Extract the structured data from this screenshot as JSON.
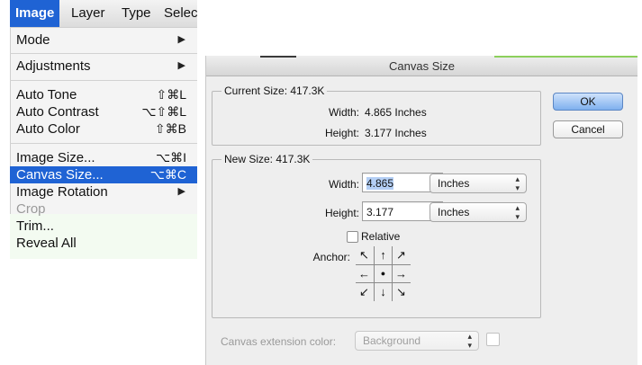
{
  "menubar": {
    "items": [
      "Image",
      "Layer",
      "Type",
      "Selec"
    ]
  },
  "menu": {
    "mode": {
      "label": "Mode"
    },
    "adjustments": {
      "label": "Adjustments"
    },
    "auto_tone": {
      "label": "Auto Tone",
      "shortcut": "⇧⌘L"
    },
    "auto_contrast": {
      "label": "Auto Contrast",
      "shortcut": "⌥⇧⌘L"
    },
    "auto_color": {
      "label": "Auto Color",
      "shortcut": "⇧⌘B"
    },
    "image_size": {
      "label": "Image Size...",
      "shortcut": "⌥⌘I"
    },
    "canvas_size": {
      "label": "Canvas Size...",
      "shortcut": "⌥⌘C"
    },
    "image_rotation": {
      "label": "Image Rotation"
    },
    "crop": {
      "label": "Crop"
    },
    "trim": {
      "label": "Trim..."
    },
    "reveal_all": {
      "label": "Reveal All"
    },
    "submenu_arrow": "▶"
  },
  "dialog": {
    "title": "Canvas Size",
    "current": {
      "legend": "Current Size: 417.3K",
      "width_label": "Width:",
      "width_value": "4.865 Inches",
      "height_label": "Height:",
      "height_value": "3.177 Inches"
    },
    "new_size": {
      "legend": "New Size: 417.3K",
      "width_label": "Width:",
      "width_value": "4.865",
      "width_unit": "Inches",
      "height_label": "Height:",
      "height_value": "3.177",
      "height_unit": "Inches",
      "relative_label": "Relative",
      "anchor_label": "Anchor:",
      "anchor_cells": [
        "↖",
        "↑",
        "↗",
        "←",
        "●",
        "→",
        "↙",
        "↓",
        "↘"
      ]
    },
    "extension": {
      "label": "Canvas extension color:",
      "value": "Background"
    },
    "buttons": {
      "ok": "OK",
      "cancel": "Cancel"
    }
  }
}
